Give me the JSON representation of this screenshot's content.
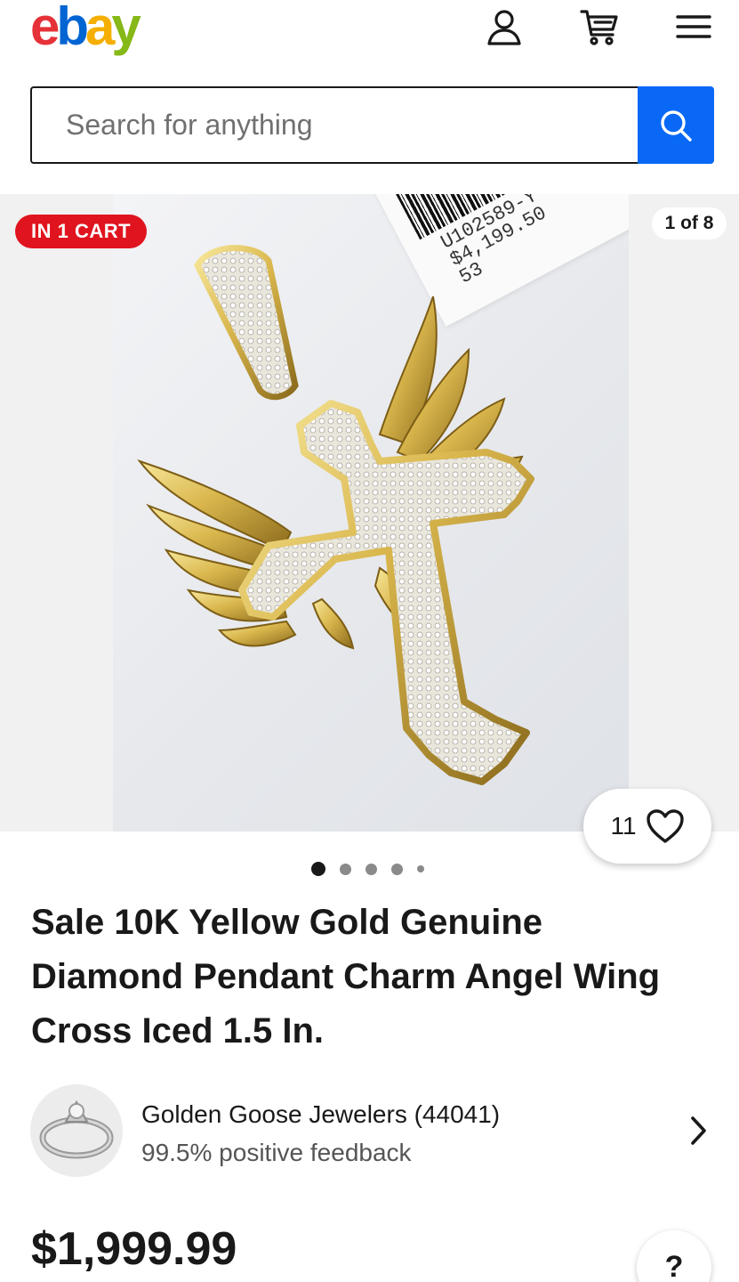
{
  "header": {
    "logo": {
      "e": "e",
      "b": "b",
      "a": "a",
      "y": "y"
    },
    "icons": {
      "user": "user-icon",
      "cart": "cart-icon",
      "menu": "hamburger-menu-icon"
    }
  },
  "search": {
    "placeholder": "Search for anything",
    "button_icon": "search-icon"
  },
  "gallery": {
    "cart_badge": "IN 1 CART",
    "counter": "1 of 8",
    "price_tag": {
      "line1": "U102589-Y",
      "line2": "$4,199.50",
      "line3": "53"
    },
    "watch_count": "11",
    "dot_count": 5,
    "active_dot": 0
  },
  "listing": {
    "title": "Sale 10K Yellow Gold Genuine Diamond Pendant Charm Angel Wing Cross Iced 1.5 In."
  },
  "seller": {
    "name": "Golden Goose Jewelers (44041)",
    "feedback": "99.5% positive feedback"
  },
  "price": {
    "value": "$1,999.99",
    "help_label": "?"
  },
  "colors": {
    "brand_red": "#e53238",
    "brand_blue": "#0064d2",
    "brand_yellow": "#f5af02",
    "brand_green": "#86b817",
    "search_button": "#0968f6",
    "cart_badge": "#e0141e"
  }
}
